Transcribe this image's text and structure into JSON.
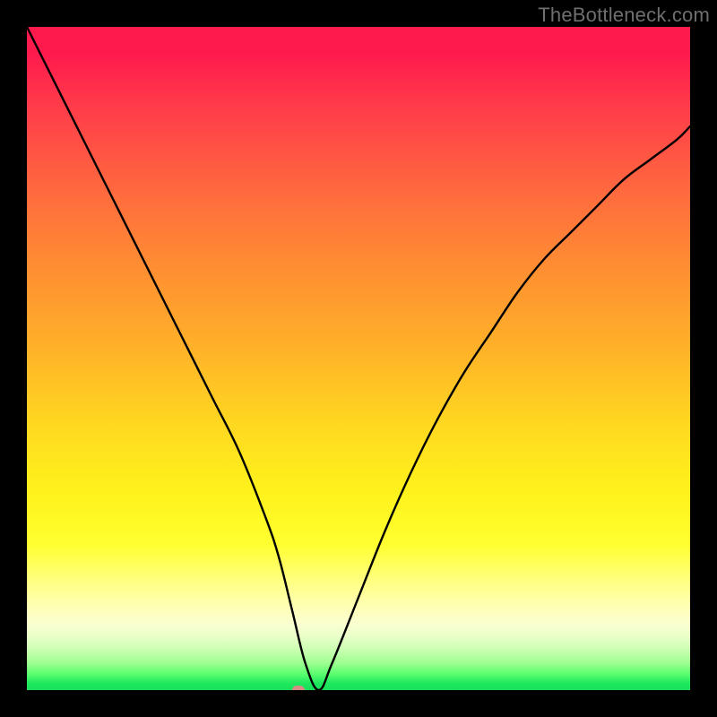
{
  "watermark": "TheBottleneck.com",
  "chart_data": {
    "type": "line",
    "title": "",
    "xlabel": "",
    "ylabel": "",
    "xlim": [
      0,
      100
    ],
    "ylim": [
      0,
      100
    ],
    "grid": false,
    "legend": false,
    "background": "rainbow-gradient",
    "series": [
      {
        "name": "bottleneck-curve",
        "x": [
          0,
          4,
          8,
          12,
          16,
          20,
          24,
          28,
          32,
          36,
          38,
          40,
          42,
          44,
          46,
          50,
          54,
          58,
          62,
          66,
          70,
          74,
          78,
          82,
          86,
          90,
          94,
          98,
          100
        ],
        "y": [
          100,
          92,
          84,
          76,
          68,
          60,
          52,
          44,
          36,
          26,
          20,
          12,
          4,
          0,
          4,
          14,
          24,
          33,
          41,
          48,
          54,
          60,
          65,
          69,
          73,
          77,
          80,
          83,
          85
        ]
      }
    ],
    "marker": {
      "x": 41,
      "y": 0,
      "color": "#d98b85"
    },
    "gradient_stops": [
      {
        "pos": 0,
        "color": "#ff1a4d"
      },
      {
        "pos": 25,
        "color": "#ff6a3e"
      },
      {
        "pos": 50,
        "color": "#ffb029"
      },
      {
        "pos": 70,
        "color": "#fff21b"
      },
      {
        "pos": 90,
        "color": "#fbffd0"
      },
      {
        "pos": 100,
        "color": "#18df5a"
      }
    ]
  }
}
